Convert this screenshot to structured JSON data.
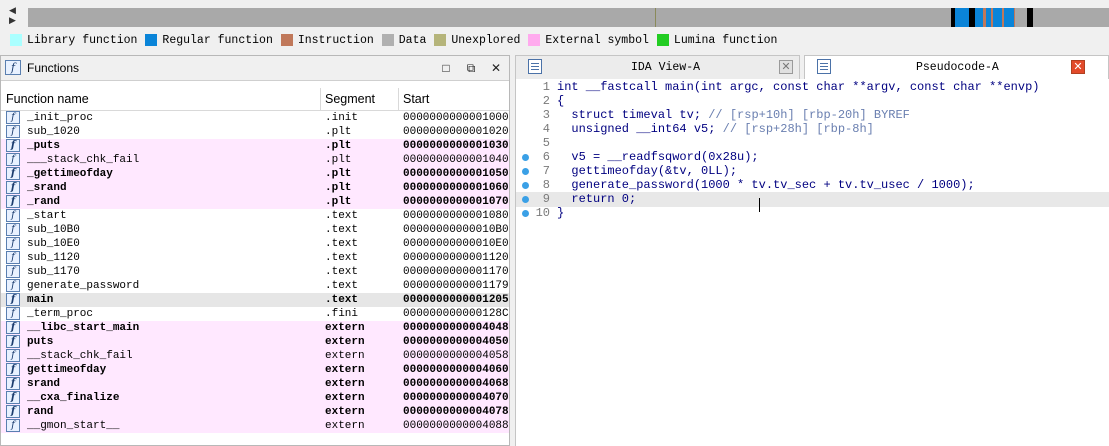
{
  "nav": {
    "colors": {
      "bar": "#a9a9a9",
      "regular": "#0078d7",
      "instruction": "#c07050",
      "dark": "#000000",
      "separator": "#7a7a7a"
    }
  },
  "legend": [
    {
      "label": "Library function",
      "color": "#aaffff"
    },
    {
      "label": "Regular function",
      "color": "#0a84d8"
    },
    {
      "label": "Instruction",
      "color": "#c0785a"
    },
    {
      "label": "Data",
      "color": "#b0b0b0"
    },
    {
      "label": "Unexplored",
      "color": "#b5b47a"
    },
    {
      "label": "External symbol",
      "color": "#ffaaee"
    },
    {
      "label": "Lumina function",
      "color": "#22cc22"
    }
  ],
  "functions_panel": {
    "title": "Functions",
    "columns": [
      "Function name",
      "Segment",
      "Start"
    ],
    "rows": [
      {
        "name": "_init_proc",
        "segment": ".init",
        "start": "0000000000001000",
        "style": "normal"
      },
      {
        "name": "sub_1020",
        "segment": ".plt",
        "start": "0000000000001020",
        "style": "normal"
      },
      {
        "name": "_puts",
        "segment": ".plt",
        "start": "0000000000001030",
        "style": "lib"
      },
      {
        "name": "___stack_chk_fail",
        "segment": ".plt",
        "start": "0000000000001040",
        "style": "libthin"
      },
      {
        "name": "_gettimeofday",
        "segment": ".plt",
        "start": "0000000000001050",
        "style": "lib"
      },
      {
        "name": "_srand",
        "segment": ".plt",
        "start": "0000000000001060",
        "style": "lib"
      },
      {
        "name": "_rand",
        "segment": ".plt",
        "start": "0000000000001070",
        "style": "lib"
      },
      {
        "name": "_start",
        "segment": ".text",
        "start": "0000000000001080",
        "style": "normal"
      },
      {
        "name": "sub_10B0",
        "segment": ".text",
        "start": "00000000000010B0",
        "style": "normal"
      },
      {
        "name": "sub_10E0",
        "segment": ".text",
        "start": "00000000000010E0",
        "style": "normal"
      },
      {
        "name": "sub_1120",
        "segment": ".text",
        "start": "0000000000001120",
        "style": "normal"
      },
      {
        "name": "sub_1170",
        "segment": ".text",
        "start": "0000000000001170",
        "style": "normal"
      },
      {
        "name": "generate_password",
        "segment": ".text",
        "start": "0000000000001179",
        "style": "normal"
      },
      {
        "name": "main",
        "segment": ".text",
        "start": "0000000000001205",
        "style": "selected"
      },
      {
        "name": "_term_proc",
        "segment": ".fini",
        "start": "000000000000128C",
        "style": "normal"
      },
      {
        "name": "__libc_start_main",
        "segment": "extern",
        "start": "0000000000004048",
        "style": "lib"
      },
      {
        "name": "puts",
        "segment": "extern",
        "start": "0000000000004050",
        "style": "lib"
      },
      {
        "name": "__stack_chk_fail",
        "segment": "extern",
        "start": "0000000000004058",
        "style": "libthin"
      },
      {
        "name": "gettimeofday",
        "segment": "extern",
        "start": "0000000000004060",
        "style": "lib"
      },
      {
        "name": "srand",
        "segment": "extern",
        "start": "0000000000004068",
        "style": "lib"
      },
      {
        "name": "__cxa_finalize",
        "segment": "extern",
        "start": "0000000000004070",
        "style": "lib"
      },
      {
        "name": "rand",
        "segment": "extern",
        "start": "0000000000004078",
        "style": "lib"
      },
      {
        "name": "__gmon_start__",
        "segment": "extern",
        "start": "0000000000004088",
        "style": "libthin"
      }
    ]
  },
  "tabs": [
    {
      "label": "IDA View-A",
      "active": false,
      "icon": "ida-view-icon"
    },
    {
      "label": "Pseudocode-A",
      "active": true,
      "icon": "pseudocode-icon"
    }
  ],
  "code_lines": [
    {
      "num": "1",
      "text": "int __fastcall main(int argc, const char **argv, const char **envp)",
      "comment": "",
      "dot": false
    },
    {
      "num": "2",
      "text": "{",
      "comment": "",
      "dot": false
    },
    {
      "num": "3",
      "text": "  struct timeval tv; ",
      "comment": "// [rsp+10h] [rbp-20h] BYREF",
      "dot": false
    },
    {
      "num": "4",
      "text": "  unsigned __int64 v5; ",
      "comment": "// [rsp+28h] [rbp-8h]",
      "dot": false
    },
    {
      "num": "5",
      "text": "",
      "comment": "",
      "dot": false
    },
    {
      "num": "6",
      "text": "  v5 = __readfsqword(0x28u);",
      "comment": "",
      "dot": true
    },
    {
      "num": "7",
      "text": "  gettimeofday(&tv, 0LL);",
      "comment": "",
      "dot": true
    },
    {
      "num": "8",
      "text": "  generate_password(1000 * tv.tv_sec + tv.tv_usec / 1000);",
      "comment": "",
      "dot": true
    },
    {
      "num": "9",
      "text": "  return 0;",
      "comment": "",
      "dot": true
    },
    {
      "num": "10",
      "text": "}",
      "comment": "",
      "dot": true
    }
  ]
}
